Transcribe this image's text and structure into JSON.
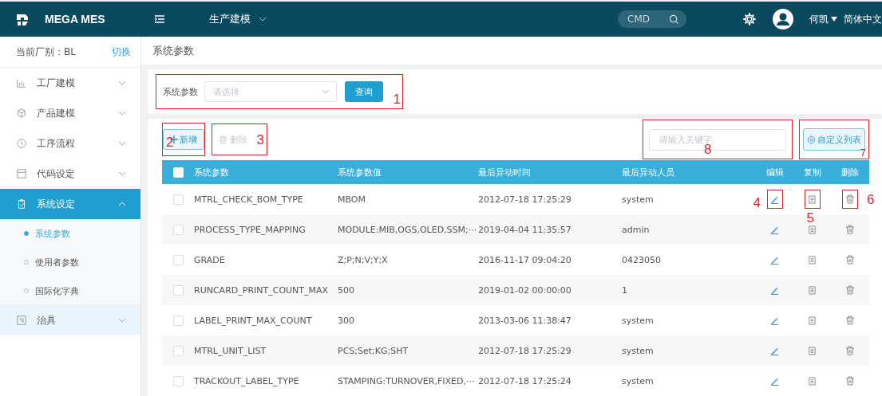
{
  "topbar": {
    "brand": "MEGA MES",
    "module": "生产建模",
    "cmd_placeholder": "CMD",
    "user": "何凯",
    "language": "简体中文"
  },
  "sidebar": {
    "factory_label": "当前厂别：BL",
    "switch_link": "切换",
    "items": [
      {
        "label": "工厂建模",
        "expanded": false,
        "selected": false,
        "hovered": false
      },
      {
        "label": "产品建模",
        "expanded": false,
        "selected": false,
        "hovered": false
      },
      {
        "label": "工序流程",
        "expanded": false,
        "selected": false,
        "hovered": false
      },
      {
        "label": "代码设定",
        "expanded": false,
        "selected": false,
        "hovered": false
      },
      {
        "label": "系统设定",
        "expanded": true,
        "selected": true,
        "hovered": false,
        "children": [
          {
            "label": "系统参数",
            "selected": true
          },
          {
            "label": "使用者参数",
            "selected": false
          },
          {
            "label": "国际化字典",
            "selected": false
          }
        ]
      },
      {
        "label": "治具",
        "expanded": false,
        "selected": false,
        "hovered": true
      }
    ]
  },
  "page_title": "系统参数",
  "filter": {
    "label": "系统参数",
    "placeholder": "请选择",
    "query_button": "查询",
    "annotation": "1"
  },
  "toolbar": {
    "add_button": "新增",
    "add_annotation": "2",
    "delete_button": "删除",
    "delete_disabled": true,
    "delete_annotation": "3",
    "search_placeholder": "请输入关键字",
    "search_annotation": "8",
    "columns_button": "自定义列表",
    "columns_annotation": "7"
  },
  "table": {
    "columns": [
      "系统参数",
      "系统参数值",
      "最后异动时间",
      "最后异动人员",
      "编辑",
      "复制",
      "删除"
    ],
    "header_checked": false,
    "action_annotations": {
      "edit": "4",
      "copy": "5",
      "delete": "6"
    },
    "rows": [
      {
        "checked": false,
        "cells": [
          "MTRL_CHECK_BOM_TYPE",
          "MBOM",
          "2012-07-18 17:25:29",
          "system"
        ]
      },
      {
        "checked": false,
        "cells": [
          "PROCESS_TYPE_MAPPING",
          "MODULE:MIB,OGS,OLED,SSM;···",
          "2019-04-04 11:35:57",
          "admin"
        ]
      },
      {
        "checked": false,
        "cells": [
          "GRADE",
          "Z;P;N;V;Y;X",
          "2016-11-17 09:04:20",
          "0423050"
        ]
      },
      {
        "checked": false,
        "cells": [
          "RUNCARD_PRINT_COUNT_MAX",
          "500",
          "2019-01-02 00:00:00",
          "1"
        ]
      },
      {
        "checked": false,
        "cells": [
          "LABEL_PRINT_MAX_COUNT",
          "300",
          "2013-03-06 11:38:47",
          "system"
        ]
      },
      {
        "checked": false,
        "cells": [
          "MTRL_UNIT_LIST",
          "PCS;Set;KG;SHT",
          "2012-07-18 17:25:29",
          "system"
        ]
      },
      {
        "checked": false,
        "cells": [
          "TRACKOUT_LABEL_TYPE",
          "STAMPING:TURNOVER,FIXED,···",
          "2012-07-18 17:25:24",
          "system"
        ]
      }
    ]
  }
}
